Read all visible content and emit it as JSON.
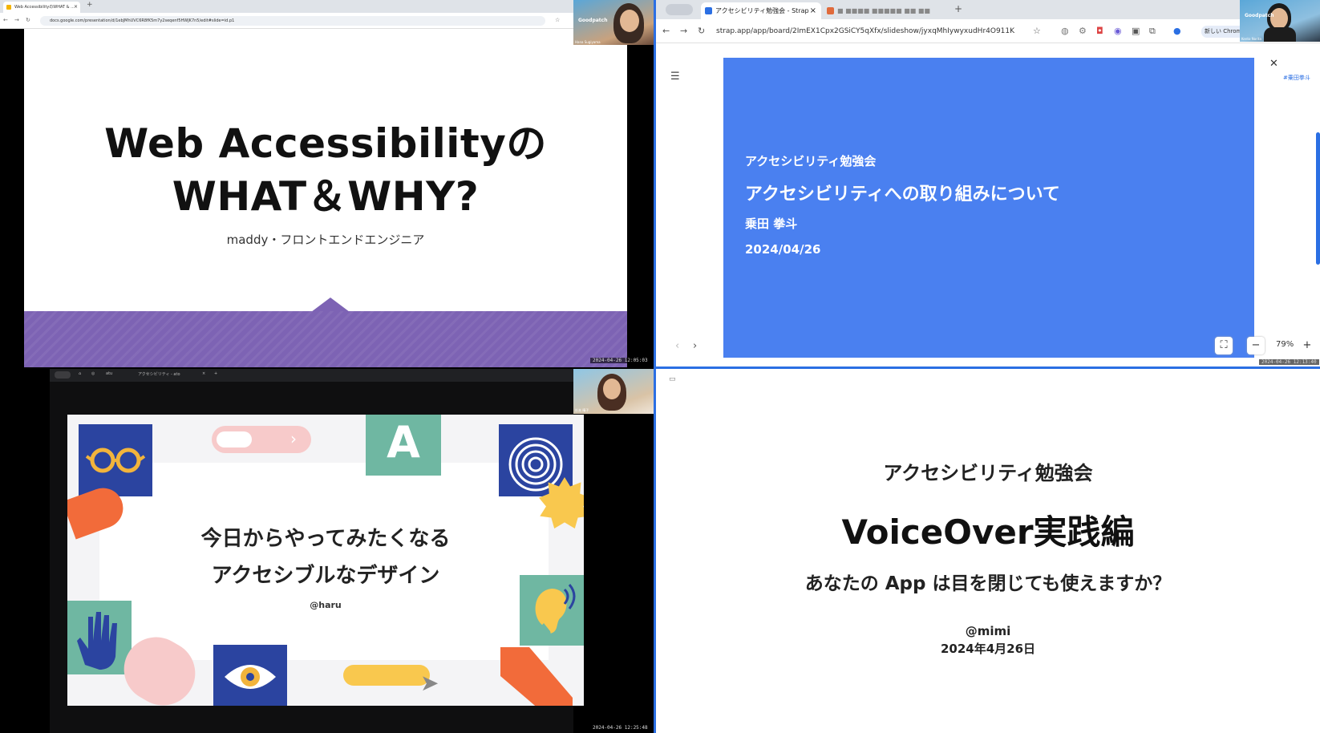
{
  "q1": {
    "tab_title": "Web AccessibilityのWHAT & ...",
    "url": "docs.google.com/presentation/d/1ebJMhUVC6R8fK5m7y2seqenf5HWJK7n5/edit#slide=id.p1",
    "slide_title_line1": "Web Accessibilityの",
    "slide_title_line2": "WHAT＆WHY?",
    "slide_subtitle": "maddy・フロントエンドエンジニア",
    "cam_name": "Hana Sugiyama",
    "cam_brand": "Goodpatch",
    "timestamp": "2024-04-26 12:05:03",
    "accent_color": "#7d63b4"
  },
  "q2": {
    "tab_active": "アクセシビリティ勉強会 - Strap",
    "tab_other": "■ ■■■■  ■■■■■ ■■ ■■",
    "url": "strap.app/app/board/2ImEX1Cpx2GSiCY5qXfx/slideshow/jyxqMhIywyxudHr4O911K",
    "new_chrome": "新しい Chrom",
    "cam_name": "Kento Norita",
    "cam_brand": "Goodpatch",
    "slide_line1": "アクセシビリティ勉強会",
    "slide_line2": "アクセシビリティへの取り組みについて",
    "slide_line3": "乗田 拳斗",
    "slide_line4": "2024/04/26",
    "side_tag": "#乗田拳斗",
    "zoom": "79%",
    "timestamp": "2024-04-26 12:13:40",
    "slide_color": "#4a80f0"
  },
  "q3": {
    "tab_label": "アクセシビリティ - ato",
    "tab_home": "atu",
    "slide_line1": "今日からやってみたくなる",
    "slide_line2": "アクセシブルなデザイン",
    "slide_author": "@haru",
    "cam_name": "杉本 晴子",
    "timestamp": "2024-04-26 12:25:48"
  },
  "q4": {
    "line1": "アクセシビリティ勉強会",
    "line2": "VoiceOver実践編",
    "line3": "あなたの App は目を閉じても使えますか？",
    "author": "@mimi",
    "date": "2024年4月26日"
  }
}
